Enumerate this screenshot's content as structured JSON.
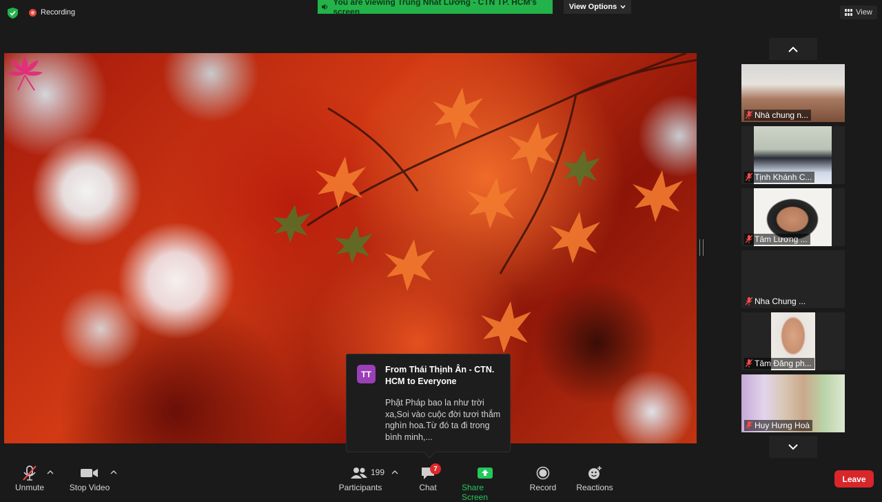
{
  "top_bar": {
    "recording_label": "Recording",
    "banner_text": "You are viewing Trung Nhất Lương - CTN TP. HCM's screen",
    "view_options_label": "View Options",
    "view_label": "View"
  },
  "gallery": {
    "tiles": [
      {
        "name": "Nhà chung n...",
        "muted": true
      },
      {
        "name": "Tịnh Khánh C...",
        "muted": true
      },
      {
        "name": "Tâm Lương ...",
        "muted": true
      },
      {
        "name": "Nha Chung ...",
        "muted": true
      },
      {
        "name": "Tâm Đăng ph...",
        "muted": true
      },
      {
        "name": "Huy Hưng Hoà",
        "muted": true
      }
    ]
  },
  "chat_popup": {
    "avatar_initials": "TT",
    "from": "From Thái Thịnh Ân - CTN. HCM to Everyone",
    "message": "Phật Pháp bao la như trời xa,Soi vào cuộc đời tươi thắm nghìn hoa.Từ đó ta đi trong bình minh,..."
  },
  "toolbar": {
    "unmute_label": "Unmute",
    "stop_video_label": "Stop Video",
    "participants_label": "Participants",
    "participants_count": "199",
    "chat_label": "Chat",
    "chat_badge": "7",
    "share_screen_label": "Share Screen",
    "record_label": "Record",
    "reactions_label": "Reactions",
    "leave_label": "Leave"
  },
  "colors": {
    "banner_green": "#23b34a",
    "leave_red": "#d8262a",
    "share_green": "#23c85a",
    "chat_avatar": "#9b3fb8"
  }
}
